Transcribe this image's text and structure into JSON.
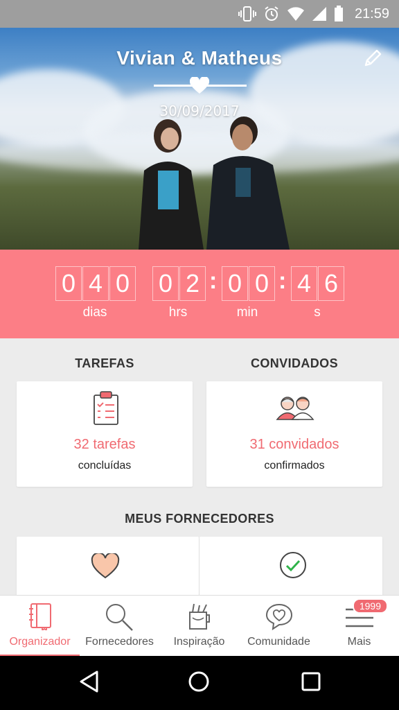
{
  "status_bar": {
    "time": "21:59",
    "icons": [
      "vibrate-icon",
      "alarm-icon",
      "wifi-icon",
      "signal-icon",
      "battery-icon"
    ]
  },
  "hero": {
    "couple": "Vivian & Matheus",
    "date": "30/09/2017"
  },
  "countdown": {
    "days": [
      "0",
      "4",
      "0"
    ],
    "hours": [
      "0",
      "2"
    ],
    "minutes": [
      "0",
      "0"
    ],
    "seconds": [
      "4",
      "6"
    ],
    "labels": {
      "days": "dias",
      "hours": "hrs",
      "minutes": "min",
      "seconds": "s"
    }
  },
  "tasks": {
    "title": "TAREFAS",
    "count": "32 tarefas",
    "sub": "concluídas"
  },
  "guests": {
    "title": "CONVIDADOS",
    "count": "31 convidados",
    "sub": "confirmados"
  },
  "vendors": {
    "title": "MEUS FORNECEDORES"
  },
  "bottom_nav": {
    "items": [
      {
        "label": "Organizador",
        "icon": "notebook-icon"
      },
      {
        "label": "Fornecedores",
        "icon": "search-icon"
      },
      {
        "label": "Inspiração",
        "icon": "cup-icon"
      },
      {
        "label": "Comunidade",
        "icon": "chat-heart-icon"
      },
      {
        "label": "Mais",
        "icon": "menu-icon"
      }
    ],
    "badge": "1999"
  },
  "colors": {
    "accent": "#f06a71",
    "countdown_bg": "#fc7e86",
    "status_bar": "#9e9e9e"
  }
}
